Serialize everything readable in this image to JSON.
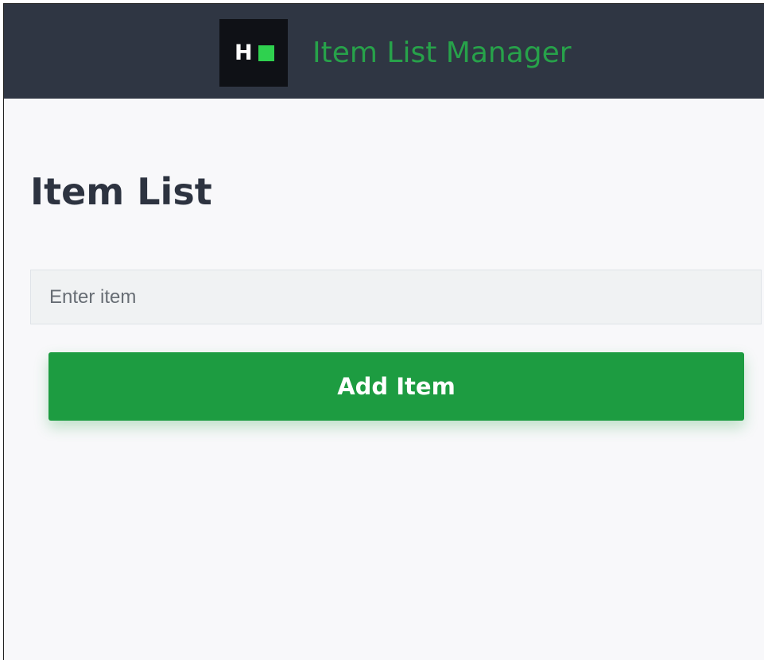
{
  "header": {
    "logo": {
      "letter": "H",
      "icon": "hackerrank-logo-icon",
      "accent_color": "#2fd14f"
    },
    "app_title": "Item List Manager",
    "title_color": "#27a24a",
    "background_color": "#2f3643"
  },
  "main": {
    "page_title": "Item List",
    "input": {
      "value": "",
      "placeholder": "Enter item"
    },
    "add_button": {
      "label": "Add Item",
      "color": "#1d9c41"
    }
  }
}
